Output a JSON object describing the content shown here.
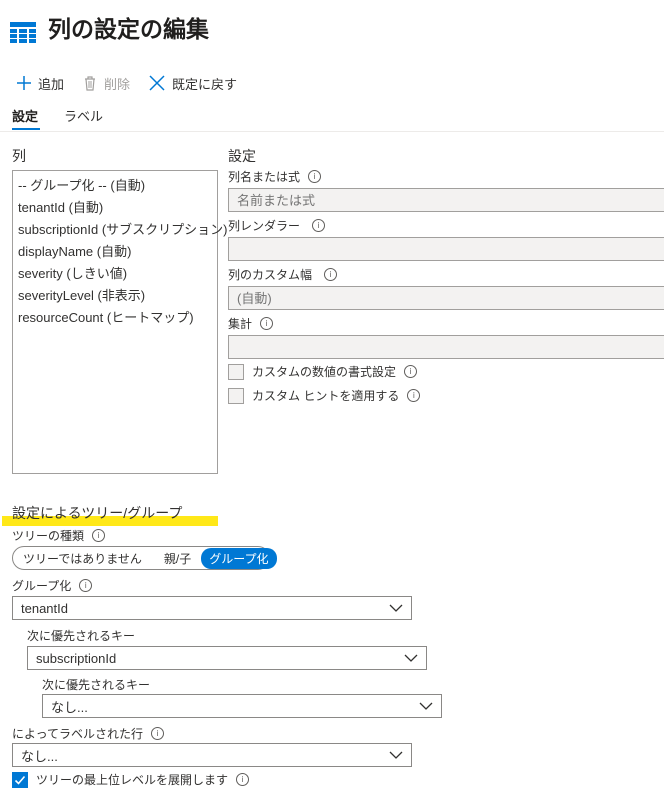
{
  "header": {
    "title": "列の設定の編集",
    "icon": "table-icon"
  },
  "toolbar": {
    "add_label": "追加",
    "delete_label": "削除",
    "reset_label": "既定に戻す"
  },
  "tabs": [
    {
      "label": "設定",
      "active": true
    },
    {
      "label": "ラベル",
      "active": false
    }
  ],
  "columns": {
    "heading": "列",
    "items": [
      "-- グループ化 -- (自動)",
      "tenantId (自動)",
      "subscriptionId (サブスクリプション)",
      "displayName (自動)",
      "severity (しきい値)",
      "severityLevel (非表示)",
      "resourceCount (ヒートマップ)"
    ]
  },
  "settings": {
    "heading": "設定",
    "name_label": "列名または式",
    "name_placeholder": "名前または式",
    "renderer_label": "列レンダラー",
    "renderer_value": "",
    "width_label": "列のカスタム幅",
    "width_placeholder": "(自動)",
    "aggregation_label": "集計",
    "aggregation_value": "",
    "custom_number_format_label": "カスタムの数値の書式設定",
    "custom_number_format_checked": false,
    "custom_hint_label": "カスタム ヒントを適用する",
    "custom_hint_checked": false
  },
  "tree": {
    "heading": "設定によるツリー/グループ",
    "tree_type_label": "ツリーの種類",
    "tree_type_options": [
      "ツリーではありません",
      "親/子",
      "グループ化"
    ],
    "tree_type_selected": "グループ化",
    "group_by_label": "グループ化",
    "group_by_value": "tenantId",
    "then_by_label_1": "次に優先されるキー",
    "then_by_value_1": "subscriptionId",
    "then_by_label_2": "次に優先されるキー",
    "then_by_value_2": "なし...",
    "label_rows_by_label": "によってラベルされた行",
    "label_rows_by_value": "なし...",
    "expand_top_label": "ツリーの最上位レベルを展開します",
    "expand_top_checked": true
  },
  "colors": {
    "accent": "#0078d4",
    "highlight": "#ffe818"
  }
}
